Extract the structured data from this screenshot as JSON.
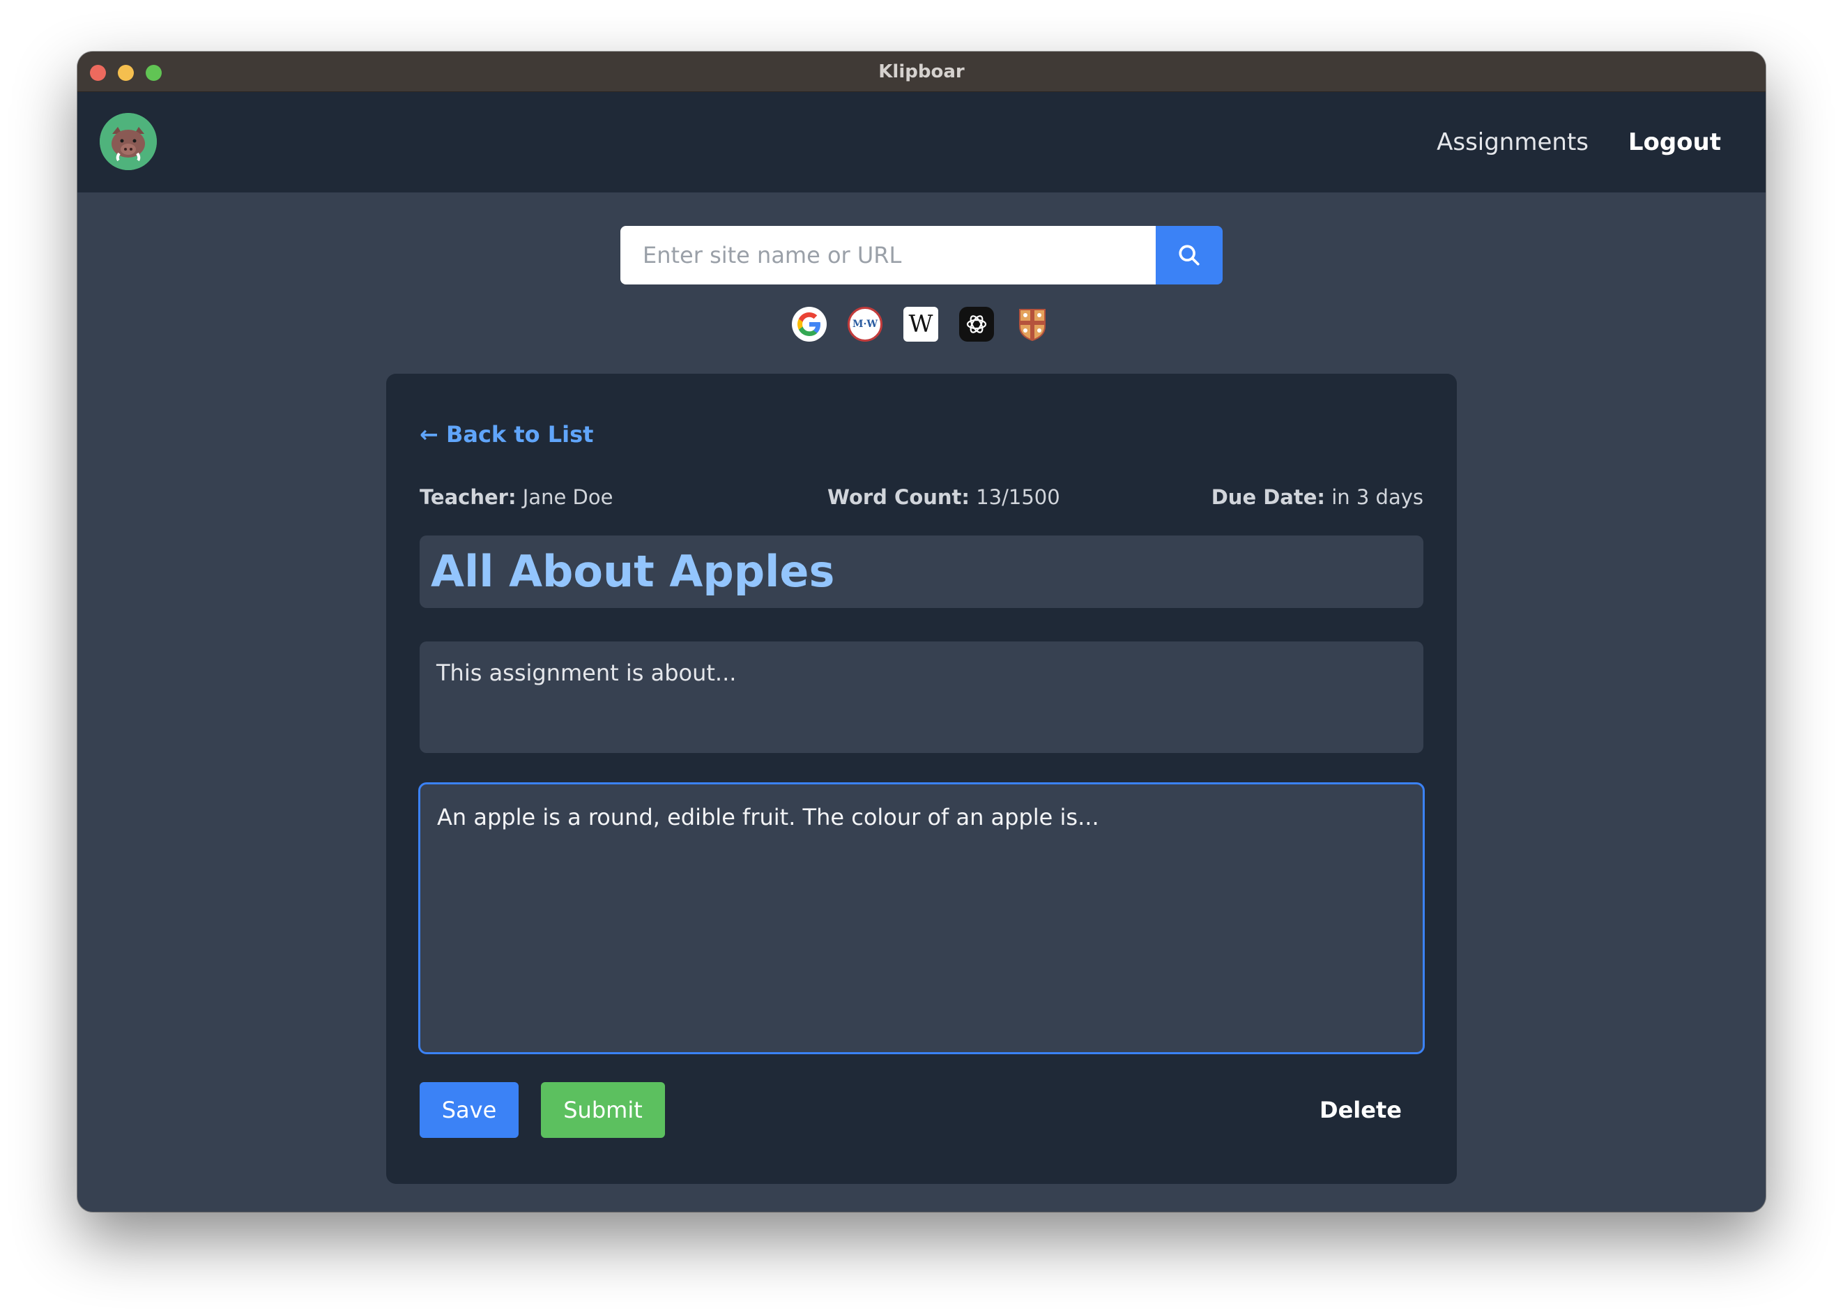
{
  "window": {
    "title": "Klipboar"
  },
  "nav": {
    "assignments": "Assignments",
    "logout": "Logout"
  },
  "search": {
    "placeholder": "Enter site name or URL"
  },
  "quick_links": {
    "mw_label": "M·W",
    "wiki_label": "W"
  },
  "assignment": {
    "back_label": "← Back to List",
    "teacher_label": "Teacher:",
    "teacher_value": "Jane Doe",
    "wordcount_label": "Word Count:",
    "wordcount_value": "13/1500",
    "due_label": "Due Date:",
    "due_value": "in 3 days",
    "title": "All About Apples",
    "description": "This assignment is about...",
    "body": "An apple is a round, edible fruit. The colour of an apple is..."
  },
  "actions": {
    "save": "Save",
    "submit": "Submit",
    "delete": "Delete"
  },
  "colors": {
    "accent_blue": "#3b82f6",
    "submit_green": "#5cc05f",
    "title_blue": "#93c5fd",
    "link_blue": "#60a5fa"
  }
}
